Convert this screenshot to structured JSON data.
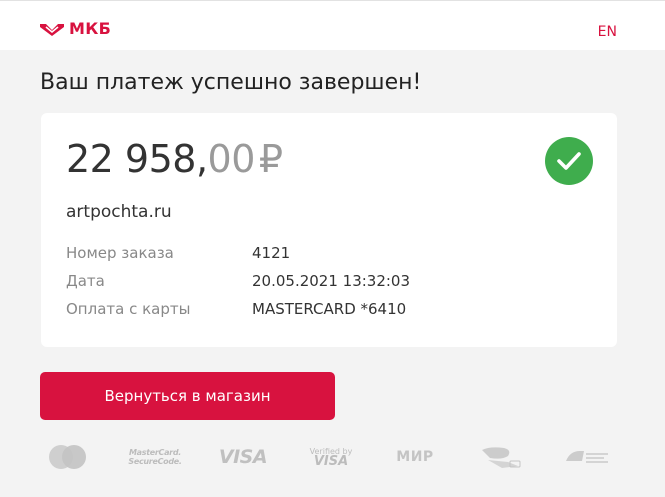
{
  "header": {
    "logo_text": "МКБ",
    "lang_label": "EN"
  },
  "page": {
    "title": "Ваш платеж успешно завершен!"
  },
  "payment": {
    "amount_main": "22 958,",
    "amount_cents": "00",
    "currency": "₽",
    "merchant": "artpochta.ru",
    "details": [
      {
        "label": "Номер заказа",
        "value": "4121"
      },
      {
        "label": "Дата",
        "value": "20.05.2021 13:32:03"
      },
      {
        "label": "Оплата с карты",
        "value": "MASTERCARD *6410"
      }
    ]
  },
  "actions": {
    "return_label": "Вернуться в магазин"
  },
  "payment_logos": {
    "mc_securecode_line1": "MasterCard.",
    "mc_securecode_line2": "SecureCode.",
    "visa": "VISA",
    "vbv_line1": "Verified by",
    "vbv_line2": "VISA",
    "mir": "МИР"
  },
  "colors": {
    "brand": "#d8123f",
    "success": "#3fad4d",
    "background": "#f3f3f3"
  },
  "icons": [
    "mkb-logo-icon",
    "success-check-icon",
    "mastercard-icon",
    "mastercard-securecode-icon",
    "visa-icon",
    "verified-by-visa-icon",
    "mir-icon",
    "mir-accept-icon",
    "pci-dss-icon"
  ]
}
